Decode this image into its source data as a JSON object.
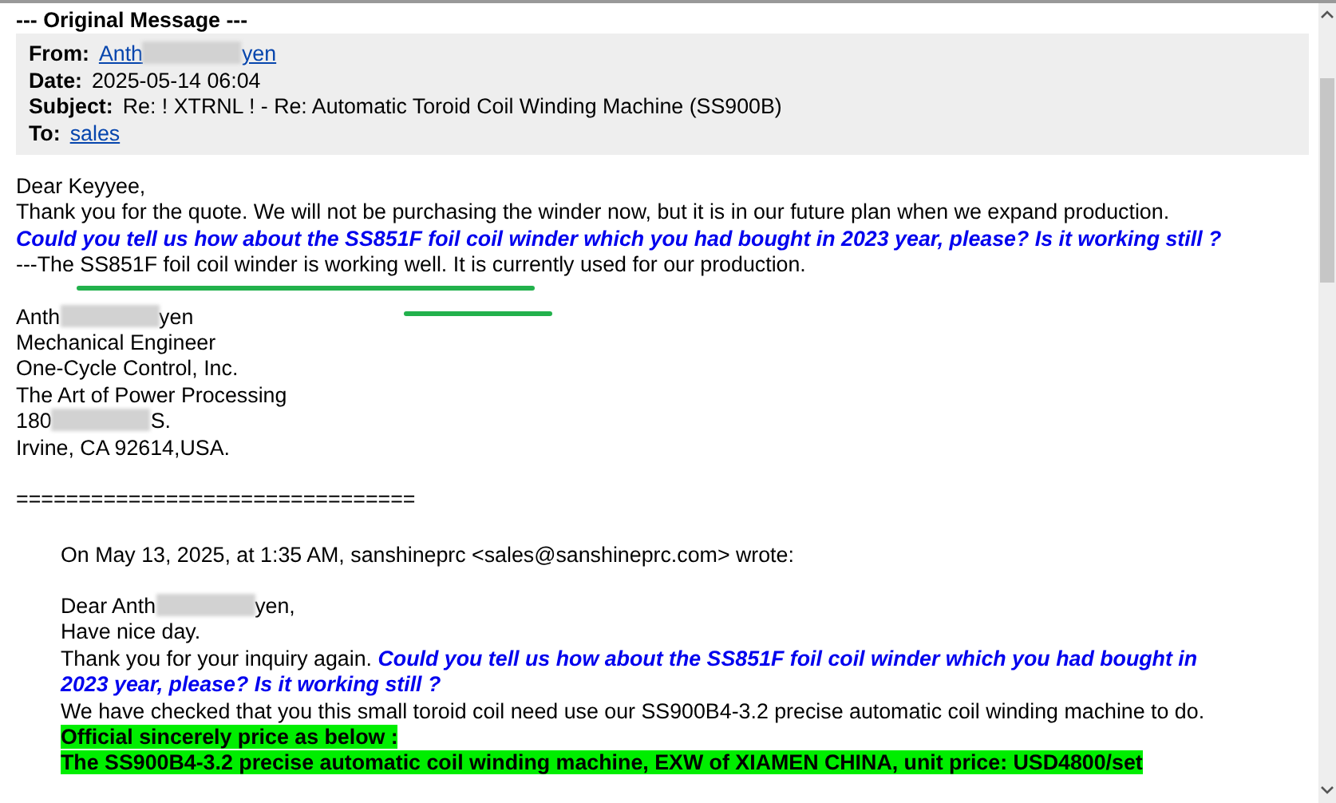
{
  "header_title": "--- Original Message ---",
  "headers": [
    {
      "label": "From:",
      "value": "Anth",
      "value_end": "yen",
      "kind": "redacted-link"
    },
    {
      "label": "Date:",
      "value": "2025-05-14 06:04",
      "kind": "text"
    },
    {
      "label": "Subject:",
      "value": "Re: ! XTRNL ! - Re: Automatic Toroid Coil Winding Machine (SS900B)",
      "kind": "text"
    },
    {
      "label": "To:",
      "value": "sales",
      "kind": "link"
    }
  ],
  "body": [
    {
      "kind": "text",
      "text": "Dear Keyyee,"
    },
    {
      "kind": "text",
      "text": "Thank you for the quote.  We will not be purchasing the winder now, but it is in our future plan when we expand production."
    },
    {
      "kind": "answer",
      "question": "Could you tell us how about the SS851F foil coil winder which you had bought in 2023 year, please? Is it working still ?",
      "text": " ---The SS851F foil coil winder is working well.  It is currently used for our production."
    },
    {
      "kind": "gap"
    },
    {
      "kind": "redacted",
      "text": "Anth",
      "text_end": "yen"
    },
    {
      "kind": "text",
      "text": "Mechanical Engineer"
    },
    {
      "kind": "text",
      "text": "One-Cycle Control, Inc."
    },
    {
      "kind": "text",
      "text": "The Art of Power Processing"
    },
    {
      "kind": "redacted",
      "text": "180",
      "text_end": "S."
    },
    {
      "kind": "text",
      "text": "Irvine, CA  92614,USA."
    },
    {
      "kind": "gap"
    },
    {
      "kind": "text",
      "text": "================================"
    }
  ],
  "quoted": [
    {
      "kind": "text",
      "text": "On May 13, 2025, at 1:35 AM, sanshineprc <sales@sanshineprc.com> wrote:"
    },
    {
      "kind": "gap"
    },
    {
      "kind": "redacted",
      "text": "Dear Anth",
      "text_end": "yen,"
    },
    {
      "kind": "text",
      "text": "Have nice day."
    },
    {
      "kind": "question",
      "text": "Thank you for your inquiry again. ",
      "question": "Could you tell us how about the SS851F foil coil winder which you had bought in 2023 year, please? Is it working still ?"
    },
    {
      "kind": "text",
      "text": "We have checked that you this small toroid coil need use our SS900B4-3.2 precise automatic coil winding machine to do."
    },
    {
      "kind": "highlight",
      "text": "Official sincerely price as below :"
    },
    {
      "kind": "highlight",
      "text": "The SS900B4-3.2 precise automatic coil winding machine, EXW of XIAMEN CHINA, unit price: USD4800/set"
    }
  ]
}
